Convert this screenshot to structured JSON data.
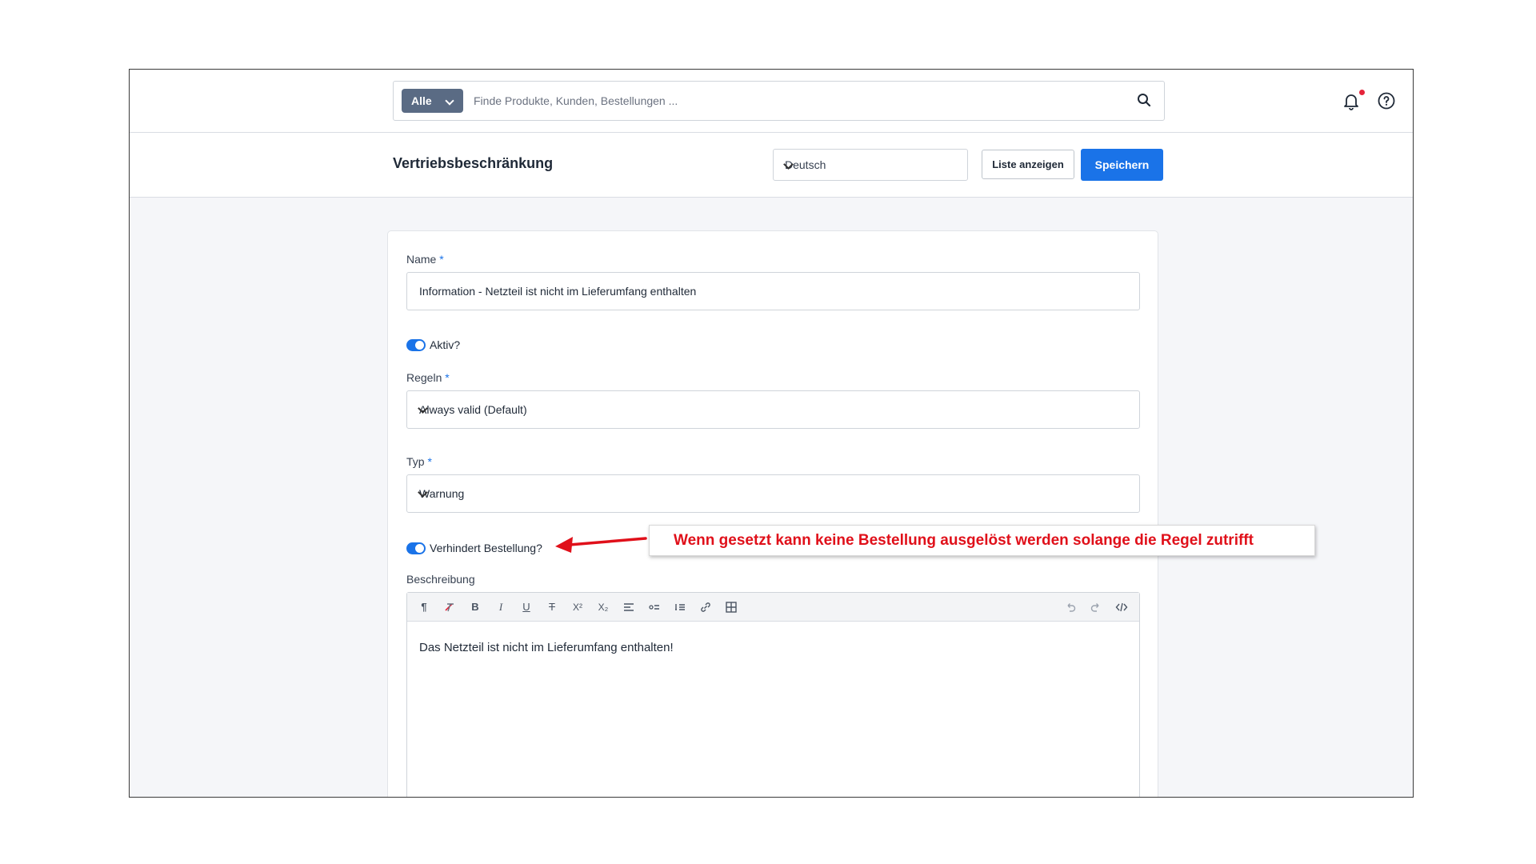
{
  "search": {
    "type_label": "Alle",
    "placeholder": "Finde Produkte, Kunden, Bestellungen ..."
  },
  "page": {
    "title": "Vertriebsbeschränkung",
    "language": "Deutsch",
    "list_button": "Liste anzeigen",
    "save_button": "Speichern"
  },
  "form": {
    "name_label": "Name",
    "name_value": "Information - Netzteil ist nicht im Lieferumfang enthalten",
    "active_label": "Aktiv?",
    "active_on": true,
    "rules_label": "Regeln",
    "rules_value": "Always valid (Default)",
    "type_label": "Typ",
    "type_value": "Warnung",
    "prevents_label": "Verhindert Bestellung?",
    "prevents_on": true,
    "description_label": "Beschreibung",
    "description_text": "Das Netzteil ist nicht im Lieferumfang enthalten!",
    "required_marker": "*"
  },
  "editor_toolbar": {
    "paragraph": "¶",
    "bold": "B",
    "italic": "I",
    "underline": "U",
    "strike": "T",
    "superscript": "X²",
    "subscript": "X₂"
  },
  "annotation": {
    "text": "Wenn gesetzt kann keine Bestellung ausgelöst werden solange die Regel zutrifft",
    "color": "#e0101a"
  },
  "colors": {
    "primary": "#1a73e8",
    "search_type_bg": "#5a6b84",
    "notification_dot": "#e5243a"
  }
}
